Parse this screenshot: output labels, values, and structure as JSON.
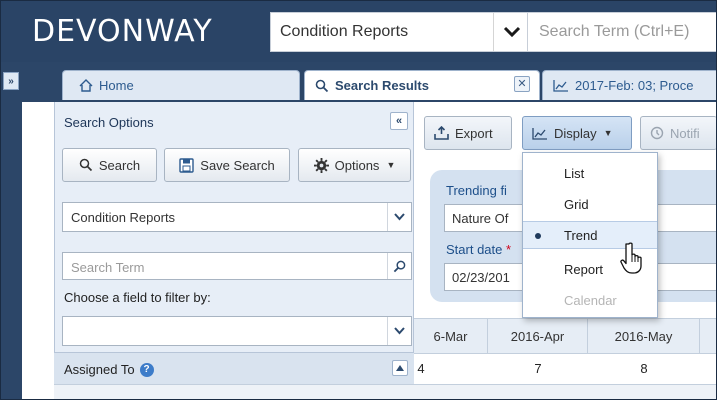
{
  "header": {
    "logo": "DEVONWAY",
    "module_select": "Condition Reports",
    "search_placeholder": "Search Term (Ctrl+E)"
  },
  "tabs": [
    {
      "label": "Home",
      "icon": "home-icon"
    },
    {
      "label": "Search Results",
      "icon": "search-icon"
    },
    {
      "label": "2017-Feb: 03; Proce",
      "icon": "chart-icon"
    }
  ],
  "search_panel": {
    "title": "Search Options",
    "buttons": {
      "search": "Search",
      "save": "Save Search",
      "options": "Options"
    },
    "module_value": "Condition Reports",
    "term_placeholder": "Search Term",
    "filter_label": "Choose a field to filter by:",
    "filter_value": "",
    "assigned_label": "Assigned To"
  },
  "toolbar": {
    "export": "Export",
    "display": "Display",
    "notify": "Notifi"
  },
  "trend": {
    "field_label": "Trending fi",
    "field_value": "Nature Of",
    "start_label": "Start date",
    "required_mark": "*",
    "start_value": "02/23/201"
  },
  "grid": {
    "headers": [
      "6-Mar",
      "2016-Apr",
      "2016-May"
    ],
    "row": [
      "4",
      "7",
      "8"
    ]
  },
  "display_menu": {
    "items": [
      {
        "label": "List",
        "selected": false,
        "disabled": false
      },
      {
        "label": "Grid",
        "selected": false,
        "disabled": false
      },
      {
        "label": "Trend",
        "selected": true,
        "disabled": false
      },
      {
        "label": "Report",
        "selected": false,
        "disabled": false
      },
      {
        "label": "Calendar",
        "selected": false,
        "disabled": true
      }
    ]
  },
  "colors": {
    "header_bg": "#2a4466",
    "panel_bg": "#e7eef7",
    "accent": "#3d7cc9",
    "trend_box": "#d4e1f0"
  }
}
